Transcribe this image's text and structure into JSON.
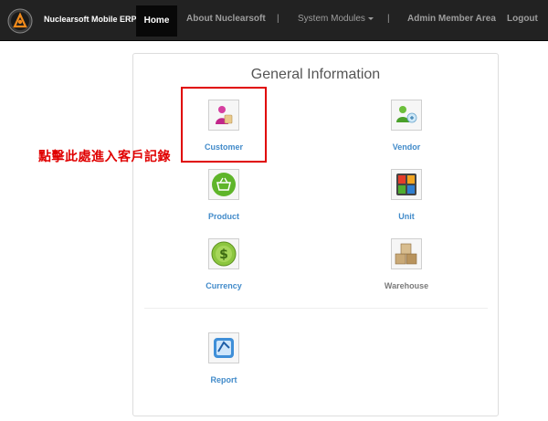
{
  "brand": {
    "name": "Nuclearsoft Mobile ERP",
    "logo_icon": "nuclearsoft-logo"
  },
  "nav": {
    "home": "Home",
    "about": "About Nuclearsoft",
    "separator": "|",
    "modules": "System Modules",
    "admin": "Admin Member Area",
    "logout": "Logout"
  },
  "panel": {
    "title": "General Information",
    "modules": [
      {
        "label": "Customer",
        "icon": "customer-icon"
      },
      {
        "label": "Vendor",
        "icon": "vendor-icon"
      },
      {
        "label": "Product",
        "icon": "product-basket-icon"
      },
      {
        "label": "Unit",
        "icon": "unit-calculator-icon"
      },
      {
        "label": "Currency",
        "icon": "currency-dollar-icon"
      },
      {
        "label": "Warehouse",
        "icon": "warehouse-boxes-icon"
      },
      {
        "label": "Report",
        "icon": "report-icon"
      }
    ]
  },
  "annotation": {
    "text": "點擊此處進入客戶記錄",
    "color": "#e00000"
  },
  "colors": {
    "navbar": "#222222",
    "link": "#428bca",
    "highlight": "#e00000"
  }
}
